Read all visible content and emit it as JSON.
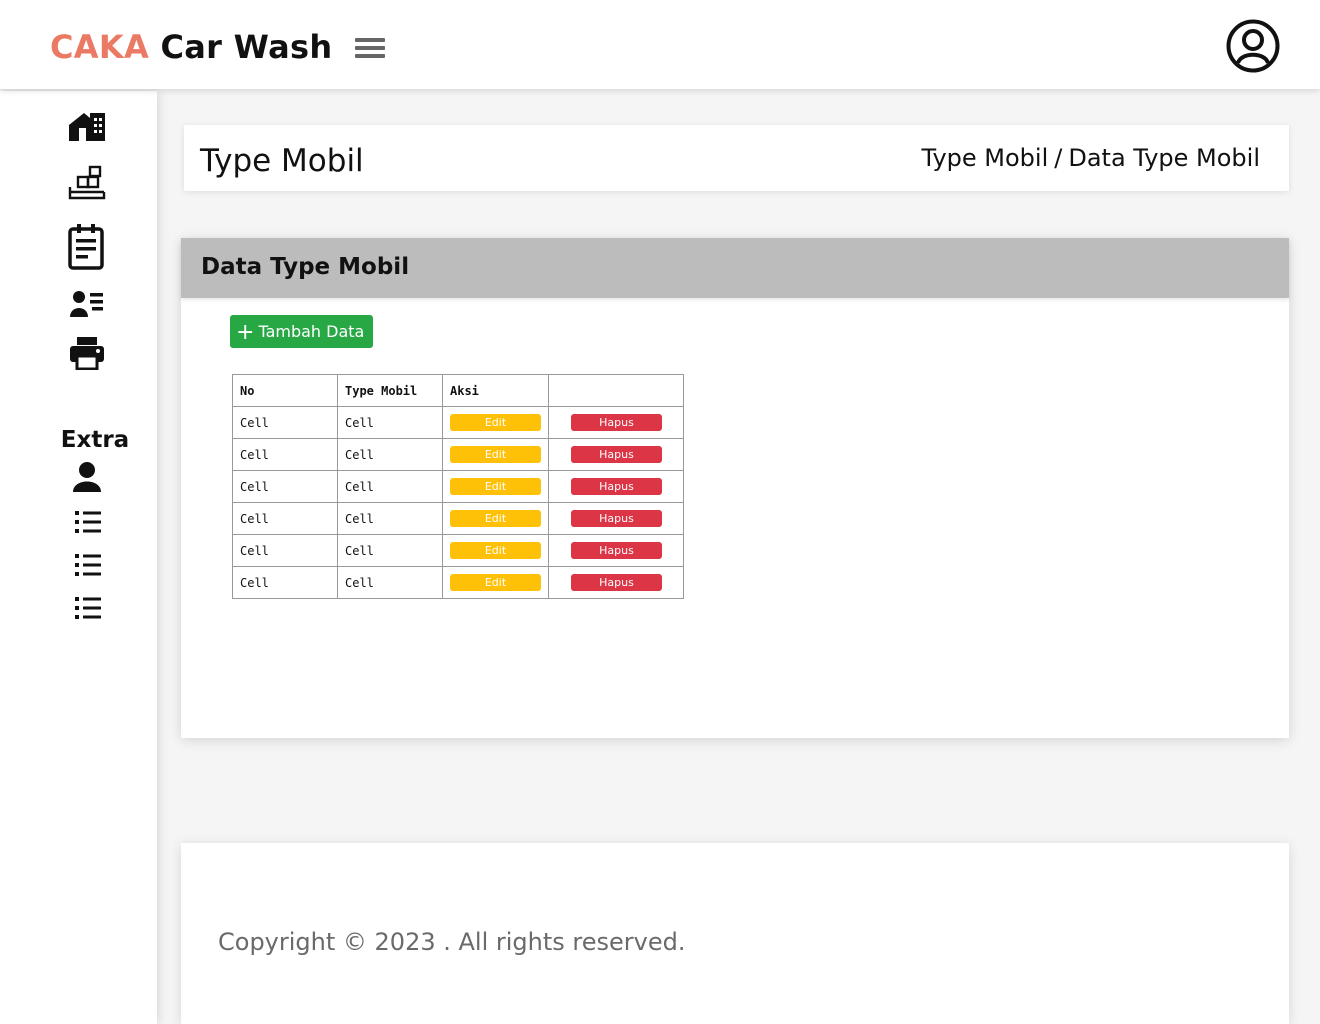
{
  "header": {
    "brand_accent": "CAKA",
    "brand_rest": " Car Wash",
    "accent_color": "#ea7a64",
    "menu_icon": "hamburger-icon",
    "profile_icon": "user-circle-icon"
  },
  "sidebar": {
    "items": [
      {
        "icon": "home-icon"
      },
      {
        "icon": "boxes-icon"
      },
      {
        "icon": "clipboard-icon"
      },
      {
        "icon": "user-list-icon"
      },
      {
        "icon": "printer-icon"
      }
    ],
    "extra_label": "Extra",
    "extra_items": [
      {
        "icon": "user-icon"
      },
      {
        "icon": "list-icon"
      },
      {
        "icon": "list-icon"
      },
      {
        "icon": "list-icon"
      }
    ]
  },
  "page": {
    "title": "Type Mobil",
    "breadcrumb": [
      "Type Mobil",
      "Data Type Mobil"
    ],
    "breadcrumb_separator": "/"
  },
  "card": {
    "title": "Data Type Mobil",
    "add_button": "Tambah Data",
    "add_color": "#27a845"
  },
  "table": {
    "headers": [
      "No",
      "Type Mobil",
      "Aksi",
      ""
    ],
    "rows": [
      {
        "no": "Cell",
        "type": "Cell",
        "edit": "Edit",
        "delete": "Hapus"
      },
      {
        "no": "Cell",
        "type": "Cell",
        "edit": "Edit",
        "delete": "Hapus"
      },
      {
        "no": "Cell",
        "type": "Cell",
        "edit": "Edit",
        "delete": "Hapus"
      },
      {
        "no": "Cell",
        "type": "Cell",
        "edit": "Edit",
        "delete": "Hapus"
      },
      {
        "no": "Cell",
        "type": "Cell",
        "edit": "Edit",
        "delete": "Hapus"
      },
      {
        "no": "Cell",
        "type": "Cell",
        "edit": "Edit",
        "delete": "Hapus"
      }
    ],
    "edit_color": "#ffc107",
    "delete_color": "#dc3545"
  },
  "footer": {
    "copyright": "Copyright © 2023 . All rights reserved."
  }
}
